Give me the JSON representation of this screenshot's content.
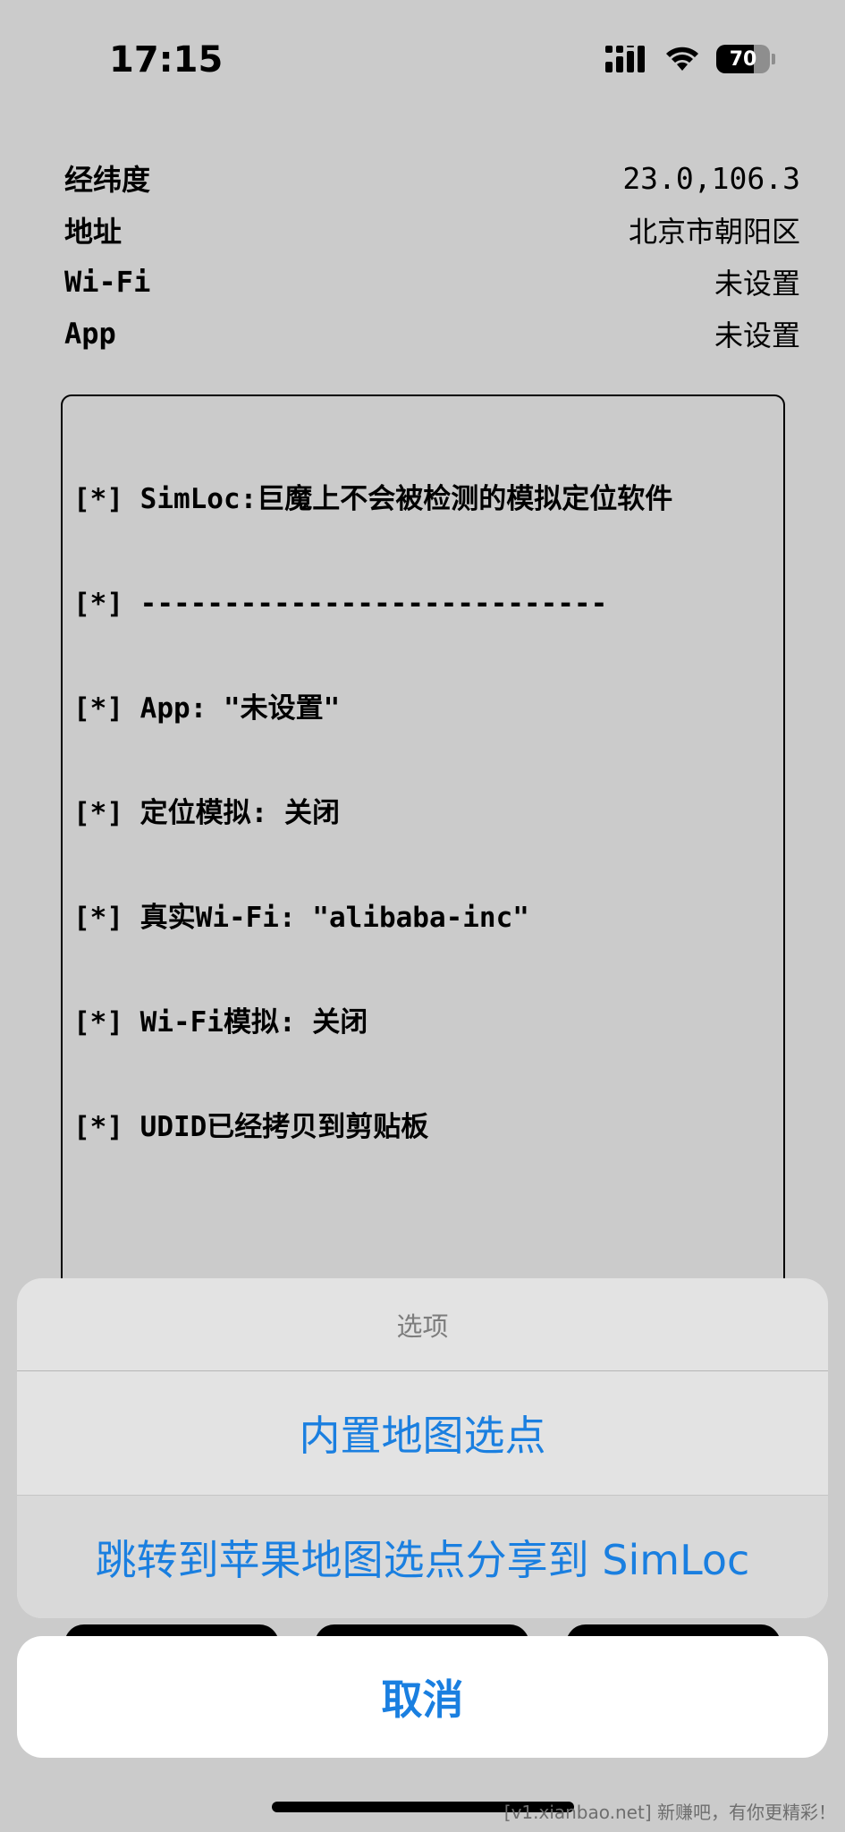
{
  "status_bar": {
    "time": "17:15",
    "battery": "70",
    "icons": [
      "signal-icon",
      "wifi-icon",
      "battery-icon"
    ]
  },
  "info": {
    "rows": [
      {
        "label": "经纬度",
        "value": "23.0,106.3"
      },
      {
        "label": "地址",
        "value": "北京市朝阳区"
      },
      {
        "label": "Wi-Fi",
        "value": "未设置"
      },
      {
        "label": "App",
        "value": "未设置"
      }
    ]
  },
  "log": {
    "lines": [
      "[*] SimLoc:巨魔上不会被检测的模拟定位软件",
      "[*] ----------------------------",
      "[*] App: \"未设置\"",
      "[*] 定位模拟: 关闭",
      "[*] 真实Wi-Fi: \"alibaba-inc\"",
      "[*] Wi-Fi模拟: 关闭",
      "[*] UDID已经拷贝到剪贴板"
    ]
  },
  "action_sheet": {
    "title": "选项",
    "options": [
      "内置地图选点",
      "跳转到苹果地图选点分享到 SimLoc"
    ],
    "cancel": "取消"
  },
  "watermark": "[v1.xianbao.net] 新赚吧，有你更精彩！",
  "colors": {
    "background": "#cbcbcb",
    "accent": "#1a7fe0"
  }
}
